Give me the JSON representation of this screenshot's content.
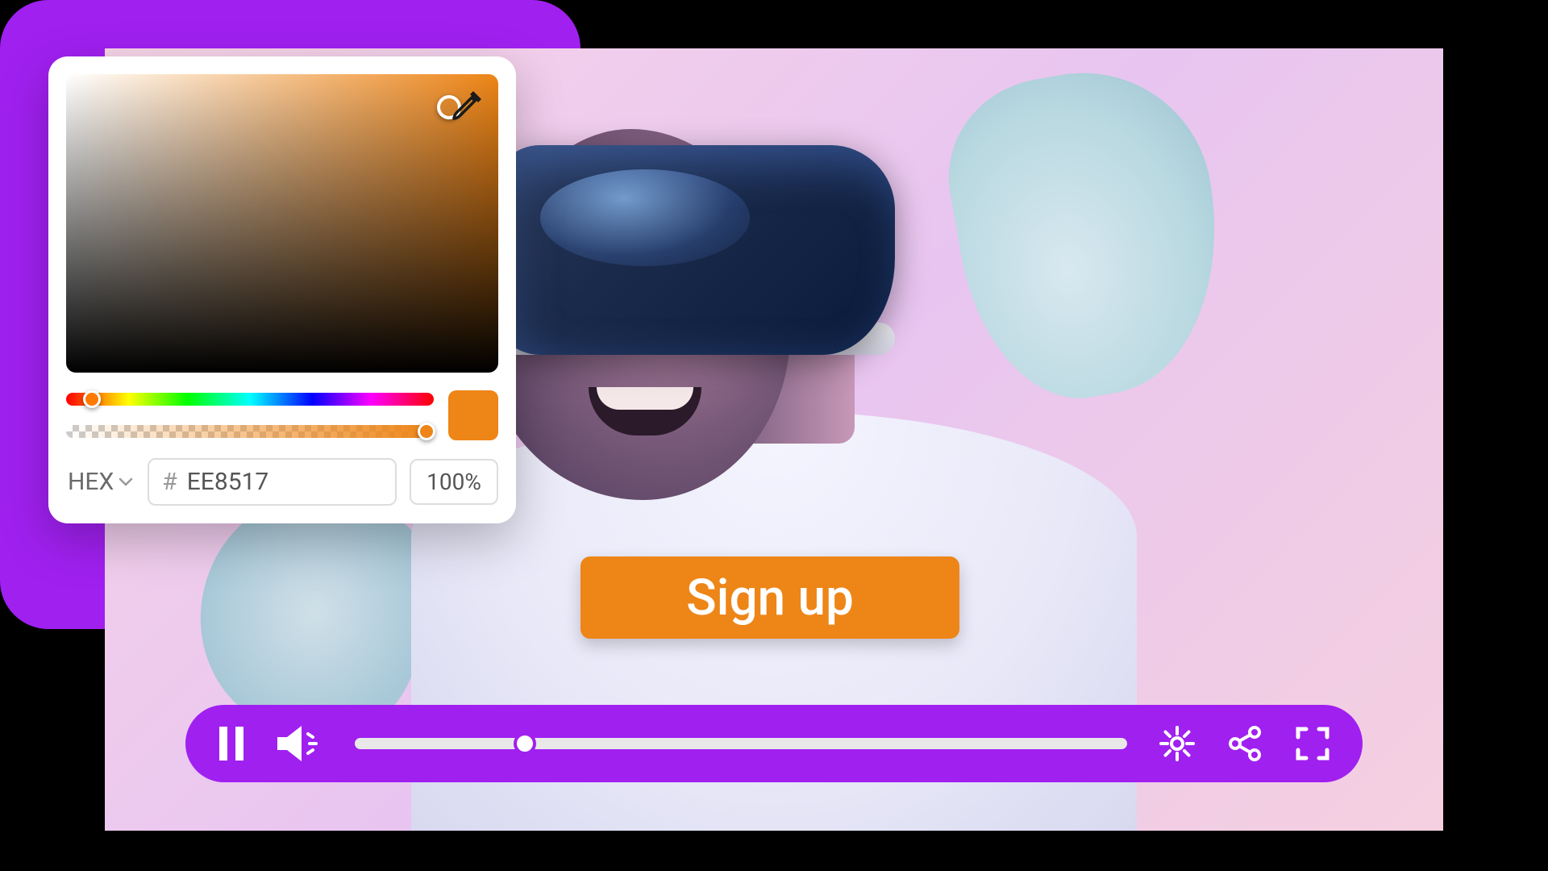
{
  "colors": {
    "accent_purple": "#a020f0",
    "accent_orange": "#ee8517"
  },
  "video": {
    "cta_label": "Sign up",
    "progress_percent": 22
  },
  "player": {
    "icons": [
      "pause",
      "volume",
      "settings",
      "share",
      "fullscreen"
    ]
  },
  "color_picker": {
    "format_label": "HEX",
    "hash": "#",
    "hex_value": "EE8517",
    "opacity_value": "100%",
    "hue_position_percent": 7,
    "alpha_position_percent": 98
  }
}
